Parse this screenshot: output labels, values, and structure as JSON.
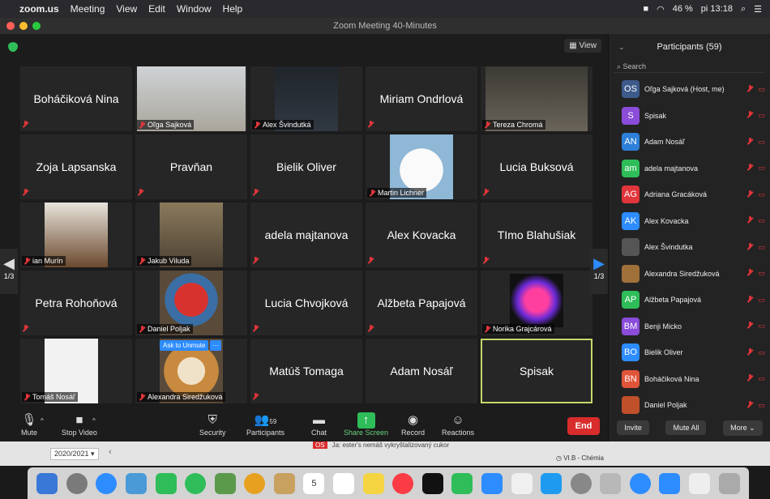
{
  "menubar": {
    "app": "zoom.us",
    "items": [
      "Meeting",
      "View",
      "Edit",
      "Window",
      "Help"
    ],
    "battery": "46 %",
    "clock": "pi 13:18"
  },
  "window": {
    "title": "Zoom Meeting  40-Minutes"
  },
  "meeting": {
    "view_label": "View",
    "page_left": "1/3",
    "page_right": "1/3",
    "tiles": [
      {
        "name": "Boháčiková Nina",
        "tag": ""
      },
      {
        "name": "",
        "tag": "Oľga Sajková",
        "photo": true
      },
      {
        "name": "",
        "tag": "Alex Švindutká",
        "photo": true
      },
      {
        "name": "Miriam Ondrlová",
        "tag": ""
      },
      {
        "name": "",
        "tag": "Tereza Chromá",
        "photo": true
      },
      {
        "name": "Zoja Lapsanska",
        "tag": ""
      },
      {
        "name": "Pravňan",
        "tag": ""
      },
      {
        "name": "Bielik Oliver",
        "tag": ""
      },
      {
        "name": "",
        "tag": "Martin Lichner",
        "photo": true
      },
      {
        "name": "Lucia Buksová",
        "tag": ""
      },
      {
        "name": "",
        "tag": "ian Murín",
        "photo": true
      },
      {
        "name": "",
        "tag": "Jakub Viluda",
        "photo": true
      },
      {
        "name": "adela majtanova",
        "tag": ""
      },
      {
        "name": "Alex Kovacka",
        "tag": ""
      },
      {
        "name": "TImo Blahušiak",
        "tag": ""
      },
      {
        "name": "Petra Rohoňová",
        "tag": ""
      },
      {
        "name": "",
        "tag": "Daniel Poljak",
        "photo": true
      },
      {
        "name": "Lucia Chvojková",
        "tag": ""
      },
      {
        "name": "Alžbeta Papajová",
        "tag": ""
      },
      {
        "name": "",
        "tag": "Norika Grajcárová",
        "photo": true
      },
      {
        "name": "",
        "tag": "Tomáš Nosáľ",
        "photo": true
      },
      {
        "name": "",
        "tag": "Alexandra Siredžuková",
        "photo": true
      },
      {
        "name": "Matúš Tomaga",
        "tag": ""
      },
      {
        "name": "Adam Nosáľ",
        "tag": ""
      },
      {
        "name": "Spisak",
        "tag": ""
      }
    ],
    "ask_to_unmute": "Ask to Unmute",
    "more": "···"
  },
  "toolbar": {
    "mute": "Mute",
    "stop_video": "Stop Video",
    "security": "Security",
    "participants": "Participants",
    "participants_count": "59",
    "chat": "Chat",
    "share_screen": "Share Screen",
    "record": "Record",
    "reactions": "Reactions",
    "end": "End"
  },
  "panel": {
    "title": "Participants (59)",
    "search_placeholder": "Search",
    "participants": [
      {
        "initials": "OS",
        "name": "Oľga Sajková (Host, me)",
        "color": "#3c5a8a"
      },
      {
        "initials": "S",
        "name": "Spisak",
        "color": "#8a4cd9"
      },
      {
        "initials": "AN",
        "name": "Adam Nosáľ",
        "color": "#2d7fd8"
      },
      {
        "initials": "am",
        "name": "adela majtanova",
        "color": "#2ebd59"
      },
      {
        "initials": "AG",
        "name": "Adriana Gracáková",
        "color": "#e0353a"
      },
      {
        "initials": "AK",
        "name": "Alex Kovacka",
        "color": "#2d8cff"
      },
      {
        "initials": "",
        "name": "Alex Švindutka",
        "color": "#555555"
      },
      {
        "initials": "",
        "name": "Alexandra Siredžuková",
        "color": "#a0703a"
      },
      {
        "initials": "AP",
        "name": "Alžbeta Papajová",
        "color": "#2ebd59"
      },
      {
        "initials": "BM",
        "name": "Benji Micko",
        "color": "#8a4cd9"
      },
      {
        "initials": "BO",
        "name": "Bielik Oliver",
        "color": "#2d8cff"
      },
      {
        "initials": "BN",
        "name": "Boháčiková Nina",
        "color": "#e0553a"
      },
      {
        "initials": "",
        "name": "Daniel Poljak",
        "color": "#c0502a"
      }
    ],
    "invite": "Invite",
    "mute_all": "Mute All",
    "more": "More"
  },
  "background": {
    "year": "2020/2021",
    "chat_initials": "OS",
    "chat_line": "Ja: ester's nemáš vykryštalizovaný cukor",
    "class": "VI.B - Chémia"
  },
  "dock_calendar_day": "5"
}
